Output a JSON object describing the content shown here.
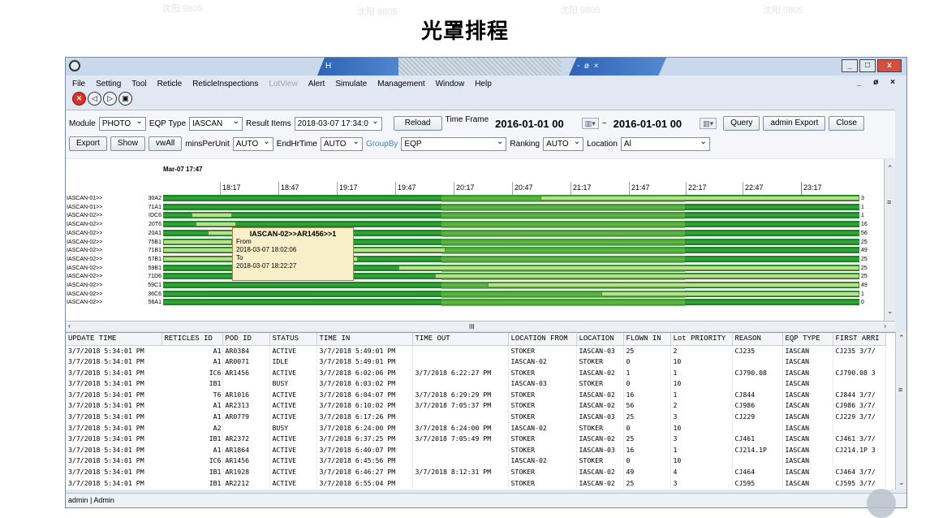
{
  "slide_title": "光罩排程",
  "watermark": "沈阳 9805",
  "window": {
    "taskbar_items": [
      "H",
      "-",
      "ø",
      "×"
    ],
    "controls": [
      "_",
      "□",
      "x"
    ]
  },
  "menu": [
    "File",
    "Setting",
    "Tool",
    "Reticle",
    "ReticleInspections",
    "LotView",
    "Alert",
    "Simulate",
    "Management",
    "Window",
    "Help"
  ],
  "menu_disabled": [
    "LotView"
  ],
  "mdi_controls": "_ ø ×",
  "toolbar": {
    "module_label": "Module",
    "module_value": "PHOTO",
    "eqp_type_label": "EQP Type",
    "eqp_type_value": "IASCAN",
    "result_items_label": "Result Items",
    "result_items_value": "2018-03-07 17:34:0",
    "reload": "Reload",
    "time_frame_label": "Time Frame",
    "time_from": "2016-01-01 00",
    "tilde": "~",
    "time_to": "2016-01-01 00",
    "query": "Query",
    "admin_export": "admin Export",
    "close": "Close",
    "export": "Export",
    "show": "Show",
    "vwall": "vwAll",
    "mins_per_unit_label": "minsPerUnit",
    "mins_per_unit_value": "AUTO",
    "end_hr_time_label": "EndHrTime",
    "end_hr_time_value": "AUTO",
    "group_by_label": "GroupBy",
    "group_by_value": "EQP",
    "ranking_label": "Ranking",
    "ranking_value": "AUTO",
    "location_label": "Location",
    "location_value": "Al"
  },
  "gantt": {
    "start_label": "Mar-07 17:47",
    "ticks": [
      "18:17",
      "18:47",
      "19:17",
      "19:47",
      "20:17",
      "20:47",
      "21:17",
      "21:47",
      "22:17",
      "22:47",
      "23:17"
    ],
    "rows": [
      {
        "eqp": "IASCAN-01>>",
        "code": "30A2",
        "count": "3"
      },
      {
        "eqp": "IASCAN-01>>",
        "code": "71A1",
        "count": "1"
      },
      {
        "eqp": "IASCAN-02>>",
        "code": "IDC6",
        "count": "1"
      },
      {
        "eqp": "IASCAN-02>>",
        "code": "20T6",
        "count": "16"
      },
      {
        "eqp": "IASCAN-02>>",
        "code": "20A1",
        "count": "56"
      },
      {
        "eqp": "IASCAN-02>>",
        "code": "75B1",
        "count": "25"
      },
      {
        "eqp": "IASCAN-02>>",
        "code": "71B1",
        "count": "49"
      },
      {
        "eqp": "IASCAN-02>>",
        "code": "57B1",
        "count": "25"
      },
      {
        "eqp": "IASCAN-02>>",
        "code": "59B1",
        "count": "25"
      },
      {
        "eqp": "IASCAN-02>>",
        "code": "71D6",
        "count": "25"
      },
      {
        "eqp": "IASCAN-02>>",
        "code": "59C1",
        "count": "49"
      },
      {
        "eqp": "IASCAN-02>>",
        "code": "36C6",
        "count": "1"
      },
      {
        "eqp": "IASCAN-02>>",
        "code": "56A1",
        "count": "0"
      }
    ],
    "tooltip": {
      "title": "IASCAN-02>>AR1456>>1",
      "from_label": "From",
      "from_value": "2018-03-07 18:02:06",
      "to_label": "To",
      "to_value": "2018-03-07 18:22:27"
    },
    "hscroll_thumb": "III"
  },
  "table": {
    "columns": [
      "UPDATE TIME",
      "RETICLES ID",
      "POD ID",
      "STATUS",
      "TIME IN",
      "TIME OUT",
      "LOCATION FROM",
      "LOCATION",
      "FLOWN IN",
      "Lot PRIORITY",
      "REASON",
      "EQP TYPE",
      "FIRST ARRI"
    ],
    "rows": [
      [
        "3/7/2018 5:34:01 PM",
        "A1",
        "AR0384",
        "ACTIVE",
        "3/7/2018 5:49:01 PM",
        "",
        "STOKER",
        "IASCAN-03",
        "25",
        "2",
        "CJ235",
        "IASCAN",
        "CJ235 3/7/"
      ],
      [
        "3/7/2018 5:34:01 PM",
        "A1",
        "AR0071",
        "IDLE",
        "3/7/2018 5:49:01 PM",
        "",
        "IASCAN-02",
        "STOKER",
        "0",
        "10",
        "",
        "IASCAN",
        ""
      ],
      [
        "3/7/2018 5:34:01 PM",
        "IC6",
        "AR1456",
        "ACTIVE",
        "3/7/2018 6:02:06 PM",
        "3/7/2018 6:22:27 PM",
        "STOKER",
        "IASCAN-02",
        "1",
        "1",
        "CJ790.08",
        "IASCAN",
        "CJ790.08 3"
      ],
      [
        "3/7/2018 5:34:01 PM",
        "IB1",
        "",
        "BUSY",
        "3/7/2018 6:03:02 PM",
        "",
        "IASCAN-03",
        "STOKER",
        "0",
        "10",
        "",
        "IASCAN",
        ""
      ],
      [
        "3/7/2018 5:34:01 PM",
        "T6",
        "AR1016",
        "ACTIVE",
        "3/7/2018 6:04:07 PM",
        "3/7/2018 6:29:29 PM",
        "STOKER",
        "IASCAN-02",
        "16",
        "1",
        "CJ844",
        "IASCAN",
        "CJ844 3/7/"
      ],
      [
        "3/7/2018 5:34:01 PM",
        "A1",
        "AR2313",
        "ACTIVE",
        "3/7/2018 6:10:02 PM",
        "3/7/2018 7:05:37 PM",
        "STOKER",
        "IASCAN-02",
        "56",
        "2",
        "CJ986",
        "IASCAN",
        "CJ986 3/7/"
      ],
      [
        "3/7/2018 5:34:01 PM",
        "A1",
        "AR0779",
        "ACTIVE",
        "3/7/2018 6:17:26 PM",
        "",
        "STOKER",
        "IASCAN-03",
        "25",
        "3",
        "CJ229",
        "IASCAN",
        "CJ229 3/7/"
      ],
      [
        "3/7/2018 5:34:01 PM",
        "A2",
        "",
        "BUSY",
        "3/7/2018 6:24:00 PM",
        "3/7/2018 6:24:00 PM",
        "IASCAN-02",
        "STOKER",
        "0",
        "10",
        "",
        "IASCAN",
        ""
      ],
      [
        "3/7/2018 5:34:01 PM",
        "IB1",
        "AR2372",
        "ACTIVE",
        "3/7/2018 6:37:25 PM",
        "3/7/2018 7:05:49 PM",
        "STOKER",
        "IASCAN-02",
        "25",
        "3",
        "CJ461",
        "IASCAN",
        "CJ461 3/7/"
      ],
      [
        "3/7/2018 5:34:01 PM",
        "A1",
        "AR1864",
        "ACTIVE",
        "3/7/2018 6:40:07 PM",
        "",
        "STOKER",
        "IASCAN-03",
        "16",
        "1",
        "CJ214.1P",
        "IASCAN",
        "CJ214.1P 3"
      ],
      [
        "3/7/2018 5:34:01 PM",
        "IC6",
        "AR1456",
        "ACTIVE",
        "3/7/2018 6:45:56 PM",
        "",
        "IASCAN-02",
        "STOKER",
        "0",
        "10",
        "",
        "IASCAN",
        ""
      ],
      [
        "3/7/2018 5:34:01 PM",
        "IB1",
        "AR1928",
        "ACTIVE",
        "3/7/2018 6:46:27 PM",
        "3/7/2018 8:12:31 PM",
        "STOKER",
        "IASCAN-02",
        "49",
        "4",
        "CJ464",
        "IASCAN",
        "CJ464 3/7/"
      ],
      [
        "3/7/2018 5:34:01 PM",
        "IB1",
        "AR2212",
        "ACTIVE",
        "3/7/2018 6:55:04 PM",
        "",
        "STOKER",
        "IASCAN-02",
        "25",
        "3",
        "CJ595",
        "IASCAN",
        "CJ595 3/7/"
      ]
    ]
  },
  "status_bar": "admin | Admin",
  "colors": {
    "gantt_green": "#1f8a2a",
    "segment": "#b6e08a",
    "tooltip": "#f8eec8",
    "close_red": "#d8302a"
  },
  "icons": [
    "app-icon",
    "close-circle-icon",
    "back-icon",
    "forward-icon",
    "save-icon",
    "calendar-icon"
  ]
}
